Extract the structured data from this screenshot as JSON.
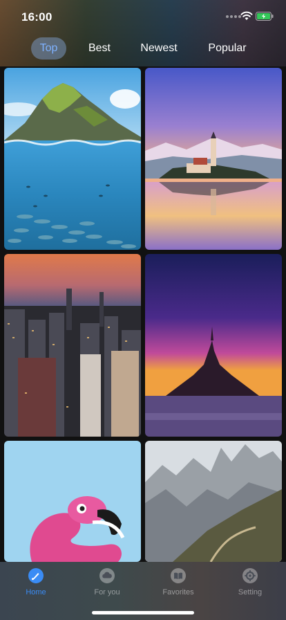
{
  "status": {
    "time": "16:00"
  },
  "top_tabs": [
    {
      "label": "Top",
      "active": true
    },
    {
      "label": "Best",
      "active": false
    },
    {
      "label": "Newest",
      "active": false
    },
    {
      "label": "Popular",
      "active": false
    }
  ],
  "wallpapers": [
    {
      "subject": "mountain island above underwater fish school"
    },
    {
      "subject": "lake church island reflection at sunset"
    },
    {
      "subject": "city skyscrapers aerial at dusk"
    },
    {
      "subject": "castle island at sunset"
    },
    {
      "subject": "pink flamingo float on blue"
    },
    {
      "subject": "rocky mountain peaks with trail"
    }
  ],
  "tab_bar": [
    {
      "label": "Home",
      "icon": "home-brush-icon",
      "active": true
    },
    {
      "label": "For you",
      "icon": "cloud-icon",
      "active": false
    },
    {
      "label": "Favorites",
      "icon": "book-icon",
      "active": false
    },
    {
      "label": "Setting",
      "icon": "gear-icon",
      "active": false
    }
  ],
  "colors": {
    "accent": "#3a8cf5",
    "active_tab_text": "#7fb2ff"
  }
}
